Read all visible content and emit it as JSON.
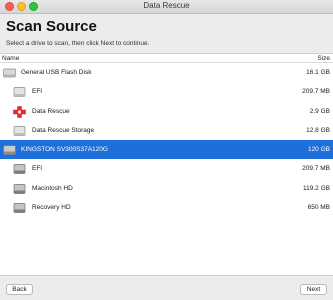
{
  "window": {
    "title": "Data Rescue"
  },
  "header": {
    "title": "Scan Source",
    "subtitle": "Select a drive to scan, then click Next to continue."
  },
  "list": {
    "columns": {
      "name": "Name",
      "size": "Size"
    },
    "rows": [
      {
        "name": "General USB Flash Disk",
        "size": "16.1 GB",
        "icon": "external-drive-icon",
        "level": 0,
        "selected": false
      },
      {
        "name": "EFI",
        "size": "209.7 MB",
        "icon": "volume-icon",
        "level": 1,
        "selected": false
      },
      {
        "name": "Data Rescue",
        "size": "2.9 GB",
        "icon": "data-rescue-red-cross-icon",
        "level": 1,
        "selected": false
      },
      {
        "name": "Data Rescue Storage",
        "size": "12.8 GB",
        "icon": "volume-icon",
        "level": 1,
        "selected": false
      },
      {
        "name": "KINGSTON SV300S37A120G",
        "size": "120 GB",
        "icon": "internal-drive-icon",
        "level": 0,
        "selected": true
      },
      {
        "name": "EFI",
        "size": "209.7 MB",
        "icon": "internal-volume-icon",
        "level": 1,
        "selected": false
      },
      {
        "name": "Macintosh HD",
        "size": "119.2 GB",
        "icon": "internal-volume-icon",
        "level": 1,
        "selected": false
      },
      {
        "name": "Recovery HD",
        "size": "650 MB",
        "icon": "internal-volume-icon",
        "level": 1,
        "selected": false
      }
    ]
  },
  "footer": {
    "back_label": "Back",
    "next_label": "Next"
  },
  "colors": {
    "selection": "#1e6fd9",
    "accent_red": "#e0312e"
  }
}
